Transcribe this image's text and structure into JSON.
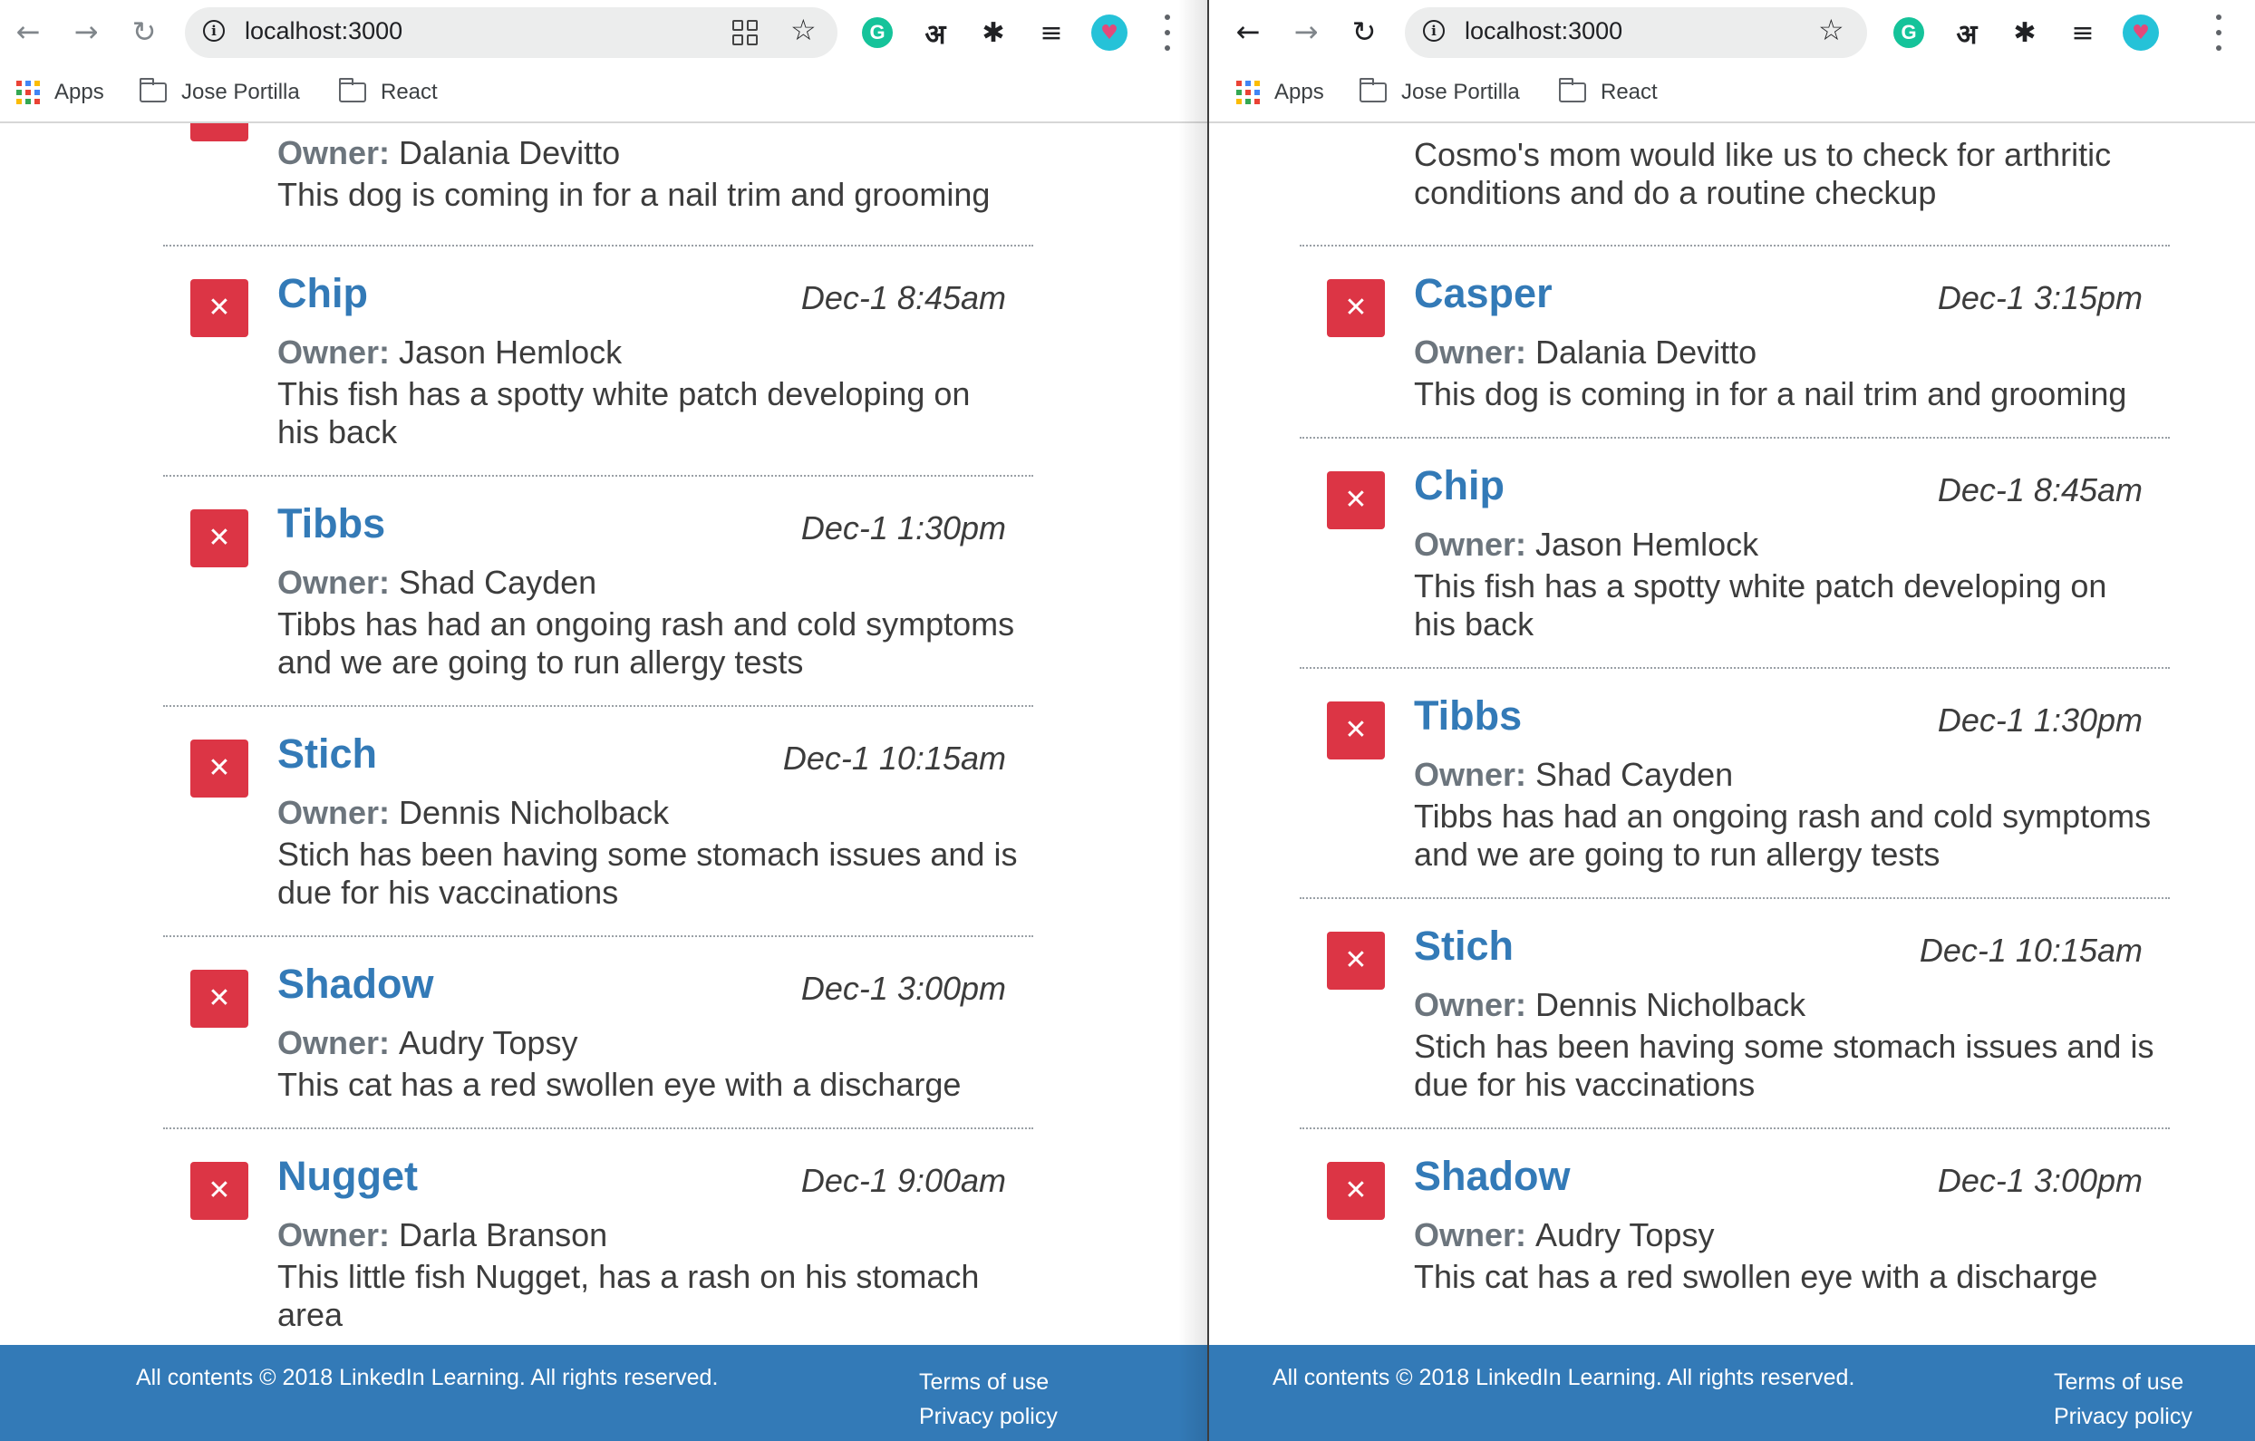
{
  "browser": {
    "url": "localhost:3000",
    "bookmarks": [
      "Apps",
      "Jose Portilla",
      "React"
    ],
    "extensions": {
      "grammarly": "G",
      "hindi": "अ"
    }
  },
  "left_window": {
    "partial_top": {
      "owner_label": "Owner:",
      "owner": "Dalania Devitto",
      "notes": "This dog is coming in for a nail trim and grooming"
    },
    "appointments": [
      {
        "pet": "Chip",
        "date": "Dec-1 8:45am",
        "owner_label": "Owner:",
        "owner": "Jason Hemlock",
        "notes": "This fish has a spotty white patch developing on his back"
      },
      {
        "pet": "Tibbs",
        "date": "Dec-1 1:30pm",
        "owner_label": "Owner:",
        "owner": "Shad Cayden",
        "notes": "Tibbs has had an ongoing rash and cold symptoms and we are going to run allergy tests"
      },
      {
        "pet": "Stich",
        "date": "Dec-1 10:15am",
        "owner_label": "Owner:",
        "owner": "Dennis Nicholback",
        "notes": "Stich has been having some stomach issues and is due for his vaccinations"
      },
      {
        "pet": "Shadow",
        "date": "Dec-1 3:00pm",
        "owner_label": "Owner:",
        "owner": "Audry Topsy",
        "notes": "This cat has a red swollen eye with a discharge"
      },
      {
        "pet": "Nugget",
        "date": "Dec-1 9:00am",
        "owner_label": "Owner:",
        "owner": "Darla Branson",
        "notes": "This little fish Nugget, has a rash on his stomach area"
      }
    ]
  },
  "right_window": {
    "partial_top": {
      "notes": "Cosmo's mom would like us to check for arthritic conditions and do a routine checkup"
    },
    "appointments": [
      {
        "pet": "Casper",
        "date": "Dec-1 3:15pm",
        "owner_label": "Owner:",
        "owner": "Dalania Devitto",
        "notes": "This dog is coming in for a nail trim and grooming"
      },
      {
        "pet": "Chip",
        "date": "Dec-1 8:45am",
        "owner_label": "Owner:",
        "owner": "Jason Hemlock",
        "notes": "This fish has a spotty white patch developing on his back"
      },
      {
        "pet": "Tibbs",
        "date": "Dec-1 1:30pm",
        "owner_label": "Owner:",
        "owner": "Shad Cayden",
        "notes": "Tibbs has had an ongoing rash and cold symptoms and we are going to run allergy tests"
      },
      {
        "pet": "Stich",
        "date": "Dec-1 10:15am",
        "owner_label": "Owner:",
        "owner": "Dennis Nicholback",
        "notes": "Stich has been having some stomach issues and is due for his vaccinations"
      },
      {
        "pet": "Shadow",
        "date": "Dec-1 3:00pm",
        "owner_label": "Owner:",
        "owner": "Audry Topsy",
        "notes": "This cat has a red swollen eye with a discharge"
      }
    ]
  },
  "footer": {
    "copyright": "All contents © 2018 LinkedIn Learning. All rights reserved.",
    "terms": "Terms of use",
    "privacy": "Privacy policy"
  },
  "colors": {
    "accent": "#337ab7",
    "delete": "#dc3545",
    "footer_bg": "#337ab7"
  },
  "icons": {
    "delete": "close-icon",
    "back": "back-arrow-icon",
    "forward": "forward-arrow-icon",
    "reload": "reload-icon",
    "bookmark": "star-icon",
    "menu": "kebab-menu-icon"
  }
}
